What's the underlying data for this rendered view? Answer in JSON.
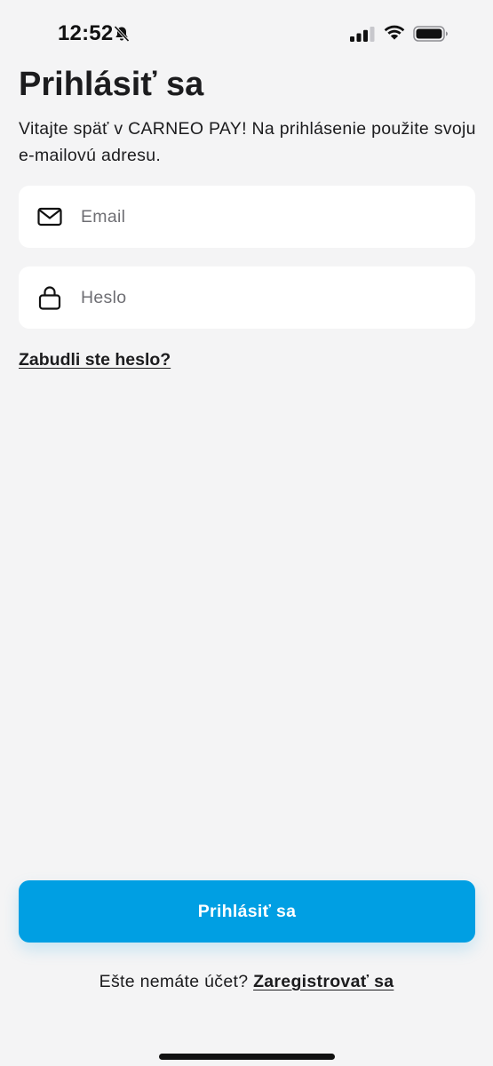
{
  "status_bar": {
    "time": "12:52",
    "icons": [
      "bell-slash-icon",
      "cellular-signal-icon",
      "wifi-icon",
      "battery-icon"
    ]
  },
  "login": {
    "title": "Prihlásiť sa",
    "subtitle": "Vitajte späť v CARNEO PAY! Na prihlásenie použite svoju e-mailovú adresu.",
    "email": {
      "placeholder": "Email",
      "value": "",
      "icon": "envelope-icon"
    },
    "password": {
      "placeholder": "Heslo",
      "value": "",
      "icon": "lock-icon"
    },
    "forgot_password": "Zabudli ste heslo?",
    "submit_label": "Prihlásiť sa",
    "register_prompt": "Ešte nemáte účet?",
    "register_link": "Zaregistrovať sa"
  },
  "colors": {
    "accent": "#009fe3",
    "background": "#f4f4f5",
    "field_background": "#ffffff",
    "text": "#1c1c1e",
    "placeholder": "#6e6e73"
  }
}
